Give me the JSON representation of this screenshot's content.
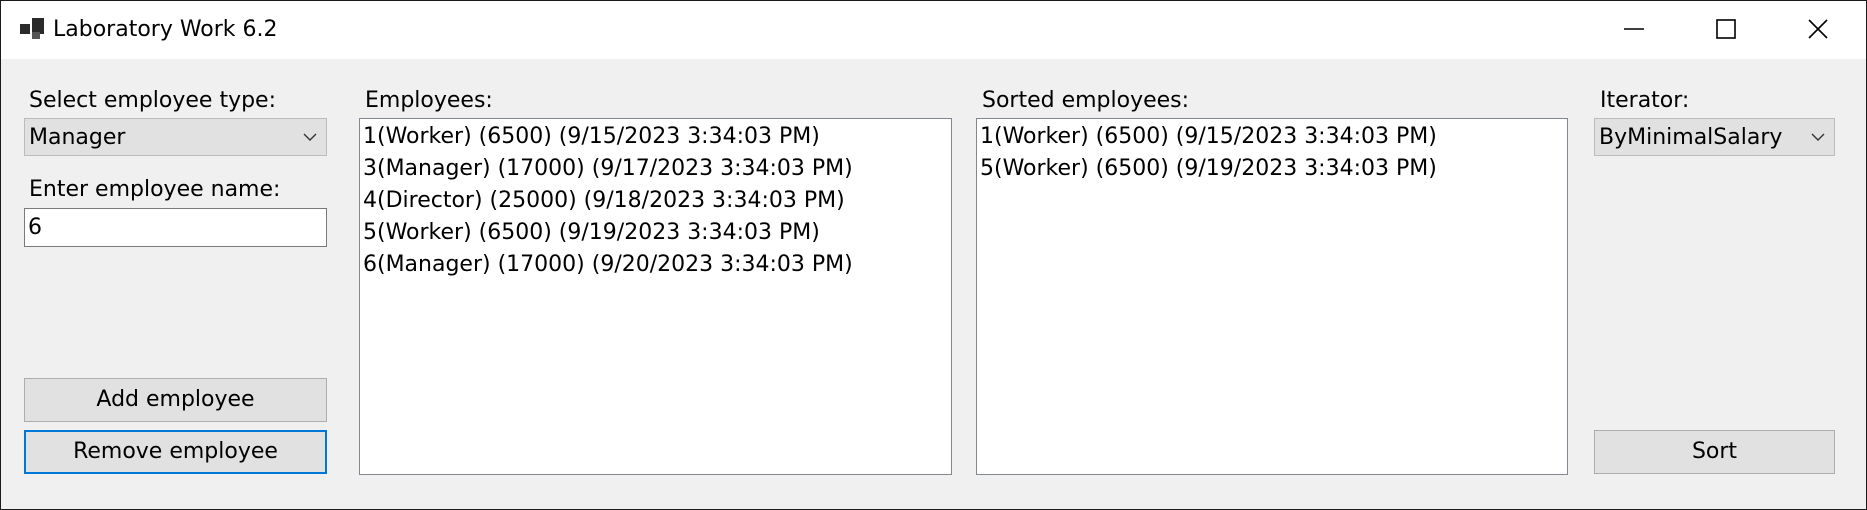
{
  "window": {
    "title": "Laboratory Work 6.2"
  },
  "left_panel": {
    "type_label": "Select employee type:",
    "type_selected": "Manager",
    "name_label": "Enter employee name:",
    "name_value": "6",
    "add_button": "Add employee",
    "remove_button": "Remove employee"
  },
  "employees": {
    "label": "Employees:",
    "items": [
      "1(Worker) (6500) (9/15/2023 3:34:03 PM)",
      "3(Manager) (17000) (9/17/2023 3:34:03 PM)",
      "4(Director) (25000) (9/18/2023 3:34:03 PM)",
      "5(Worker) (6500) (9/19/2023 3:34:03 PM)",
      "6(Manager) (17000) (9/20/2023 3:34:03 PM)"
    ]
  },
  "sorted": {
    "label": "Sorted employees:",
    "items": [
      "1(Worker) (6500) (9/15/2023 3:34:03 PM)",
      "5(Worker) (6500) (9/19/2023 3:34:03 PM)"
    ]
  },
  "iterator": {
    "label": "Iterator:",
    "selected": "ByMinimalSalary",
    "sort_button": "Sort"
  },
  "icons": {
    "app": "app-window-icon",
    "minimize": "minimize-icon",
    "maximize": "maximize-icon",
    "close": "close-icon",
    "dropdown": "chevron-down-icon"
  },
  "colors": {
    "focus_border": "#0078d7",
    "window_bg": "#f0f0f0",
    "button_bg": "#e1e1e1"
  }
}
